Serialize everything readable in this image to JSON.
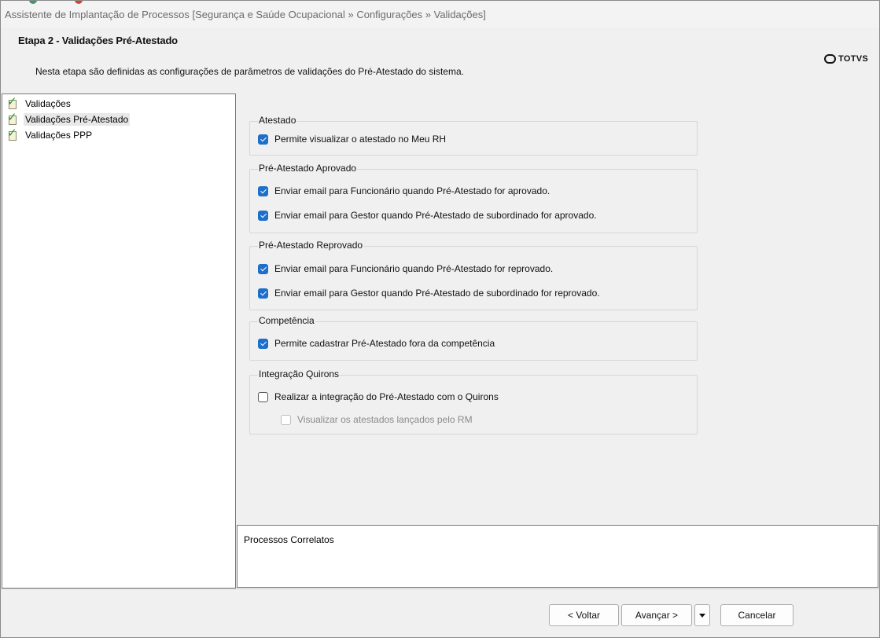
{
  "window": {
    "title": "Assistente de Implantação de Processos [Segurança e Saúde Ocupacional » Configurações » Validações]"
  },
  "header": {
    "step_title": "Etapa 2 - Validações Pré-Atestado",
    "description": "Nesta etapa são definidas as configurações de parâmetros de validações do Pré-Atestado do sistema.",
    "logo_text": "TOTVS"
  },
  "tree": {
    "items": [
      {
        "label": "Validações",
        "icon": "checklist-icon",
        "selected": false
      },
      {
        "label": "Validações Pré-Atestado",
        "icon": "checklist-icon",
        "selected": true
      },
      {
        "label": "Validações PPP",
        "icon": "checklist-icon",
        "selected": false
      }
    ]
  },
  "groups": {
    "atestado": {
      "title": "Atestado",
      "options": [
        {
          "label": "Permite visualizar o atestado no Meu RH",
          "checked": true
        }
      ]
    },
    "aprovado": {
      "title": "Pré-Atestado Aprovado",
      "options": [
        {
          "label": "Enviar email para Funcionário quando Pré-Atestado for aprovado.",
          "checked": true
        },
        {
          "label": "Enviar email para Gestor quando Pré-Atestado de subordinado for aprovado.",
          "checked": true
        }
      ]
    },
    "reprovado": {
      "title": "Pré-Atestado Reprovado",
      "options": [
        {
          "label": "Enviar email para Funcionário quando Pré-Atestado for reprovado.",
          "checked": true
        },
        {
          "label": "Enviar email para Gestor quando Pré-Atestado de subordinado for reprovado.",
          "checked": true
        }
      ]
    },
    "competencia": {
      "title": "Competência",
      "options": [
        {
          "label": "Permite cadastrar Pré-Atestado fora da competência",
          "checked": true
        }
      ]
    },
    "quirons": {
      "title": "Integração Quirons",
      "options": [
        {
          "label": "Realizar a integração do Pré-Atestado com o Quirons",
          "checked": false
        },
        {
          "label": "Visualizar os atestados lançados pelo RM",
          "checked": false,
          "disabled": true
        }
      ]
    }
  },
  "related": {
    "label": "Processos Correlatos"
  },
  "footer": {
    "back_label": "< Voltar",
    "next_label": "Avançar >",
    "cancel_label": "Cancelar"
  },
  "colors": {
    "checkbox_checked": "#1e6fc9",
    "panel_background": "#f0f0f0",
    "list_background": "#ffffff"
  }
}
